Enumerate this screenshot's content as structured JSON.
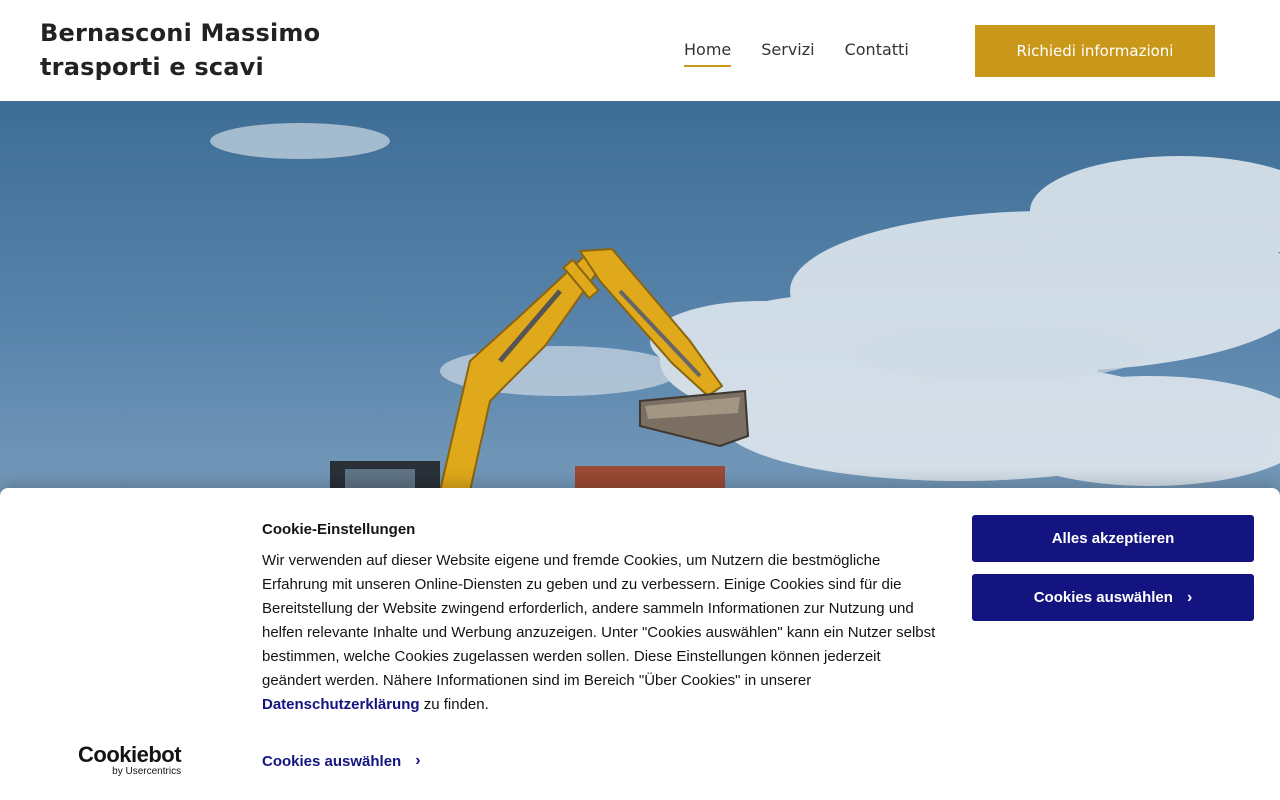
{
  "header": {
    "brand_line1": "Bernasconi Massimo",
    "brand_line2": "trasporti e scavi",
    "nav": [
      {
        "label": "Home",
        "active": true
      },
      {
        "label": "Servizi",
        "active": false
      },
      {
        "label": "Contatti",
        "active": false
      }
    ],
    "cta_label": "Richiedi informazioni",
    "accent_color": "#c9981a"
  },
  "hero": {
    "image": "excavator-against-cloudy-sky"
  },
  "cookie_banner": {
    "title": "Cookie-Einstellungen",
    "text_before_link": "Wir verwenden auf dieser Website eigene und fremde Cookies, um Nutzern die bestmögliche Erfahrung mit unseren Online-Diensten zu geben und zu verbessern. Einige Cookies sind für die Bereitstellung der Website zwingend erforderlich, andere sammeln Informationen zur Nutzung und helfen relevante Inhalte und Werbung anzuzeigen. Unter \"Cookies auswählen\" kann ein Nutzer selbst bestimmen, welche Cookies zugelassen werden sollen. Diese Einstellungen können jederzeit geändert werden. Nähere Informationen sind im Bereich \"Über Cookies\" in unserer ",
    "link_text": "Datenschutzerklärung",
    "text_after_link": " zu finden.",
    "accept_all_label": "Alles akzeptieren",
    "select_cookies_label": "Cookies auswählen",
    "select_cookies_link_label": "Cookies auswählen",
    "chevron": "›",
    "button_color": "#141480",
    "logo_main": "Cookiebot",
    "logo_sub": "by Usercentrics"
  }
}
